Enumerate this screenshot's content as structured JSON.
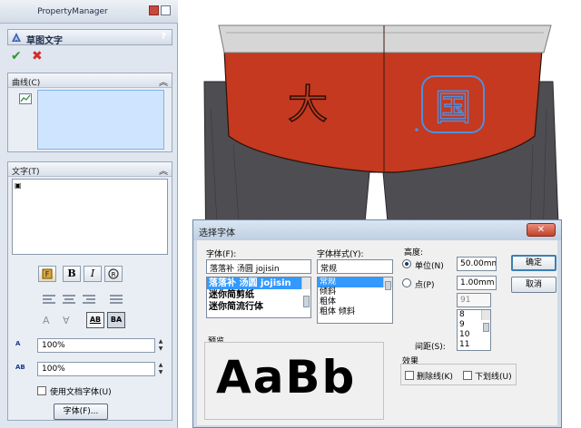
{
  "property_manager": {
    "title": "PropertyManager",
    "feature_title": "草图文字",
    "help": "?",
    "ok_symbol": "✔",
    "cancel_symbol": "✖",
    "curves_group": {
      "label": "曲线(C)",
      "chevron": "︽"
    },
    "text_group": {
      "label": "文字(T)",
      "chevron": "︽",
      "text_value": ""
    },
    "format_buttons": {
      "bold": "B",
      "italic": "I"
    },
    "width_factor": "100%",
    "spacing": "100%",
    "width_icon_label": "A",
    "spacing_icon_label": "AB",
    "use_document_font": "使用文档字体(U)",
    "font_button": "字体(F)...",
    "ab_horizontal": "AB",
    "ab_vertical": "BA"
  },
  "dialog": {
    "title": "选择字体",
    "close_symbol": "✕",
    "font_label": "字体(F):",
    "font_value": "落落补 汤圆 jojisin",
    "font_list": [
      "落落补 汤圆 jojisin",
      "迷你简剪纸",
      "迷你简流行体"
    ],
    "style_label": "字体样式(Y):",
    "style_value": "常规",
    "style_list": [
      "常规",
      "倾斜",
      "粗体",
      "粗体 倾斜"
    ],
    "height_label": "高度:",
    "unit_label": "单位(N)",
    "unit_value": "50.00mm",
    "point_label": "点(P)",
    "point_value": "1.00mm",
    "size_value": "91",
    "size_list": [
      "8",
      "9",
      "10",
      "11"
    ],
    "spacing_label": "间距(S):",
    "preview_label": "预览",
    "preview_text": "AaBb",
    "effects_label": "效果",
    "strikeout_label": "删除线(K)",
    "underline_label": "下划线(U)",
    "ok_label": "确定",
    "cancel_label": "取消"
  },
  "model": {
    "text_left": "大",
    "text_right": "国"
  },
  "colors": {
    "fabric_red": "#c4391f",
    "fabric_gray": "#4d4d52",
    "waistband": "#d6d6d6",
    "sketch_blue": "#4f8fe0",
    "selection": "#3399ff"
  }
}
